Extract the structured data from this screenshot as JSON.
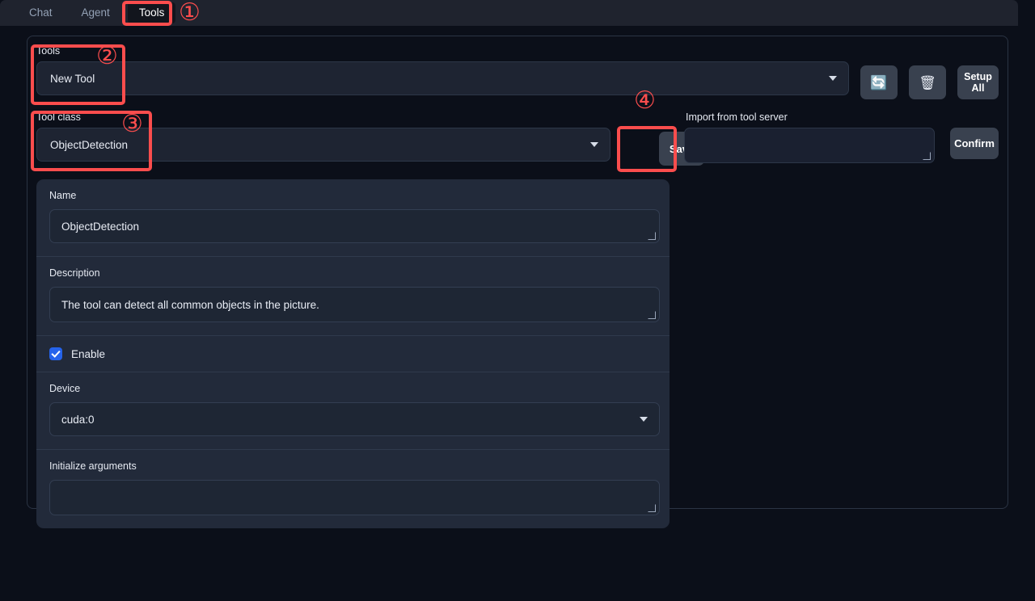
{
  "tabs": [
    {
      "label": "Chat",
      "active": false
    },
    {
      "label": "Agent",
      "active": false
    },
    {
      "label": "Tools",
      "active": true
    }
  ],
  "tools_row": {
    "label": "Tools",
    "selected": "New Tool",
    "caret_icon": "chevron-down-icon",
    "refresh_icon": "🔄",
    "delete_icon": "🗑",
    "setup_all_label": "Setup\nAll",
    "setup_all_line1": "Setup",
    "setup_all_line2": "All"
  },
  "class_row": {
    "label": "Tool class",
    "selected": "ObjectDetection",
    "save_label": "Save",
    "import_label": "Import from tool server",
    "import_value": "",
    "import_placeholder": "",
    "confirm_label": "Confirm"
  },
  "form": {
    "name_label": "Name",
    "name_value": "ObjectDetection",
    "description_label": "Description",
    "description_value": "The tool can detect all common objects in the picture.",
    "enable_label": "Enable",
    "enable_checked": true,
    "device_label": "Device",
    "device_value": "cuda:0",
    "init_args_label": "Initialize arguments",
    "init_args_value": ""
  },
  "annotations": {
    "numbers": [
      "①",
      "②",
      "③",
      "④"
    ],
    "color": "#fb4d4d"
  },
  "colors": {
    "page_bg": "#0b0f19",
    "header_bg": "#1f232e",
    "panel_bg": "#222a3a",
    "field_bg": "#1e2634",
    "button_bg": "#39414f",
    "accent_blue": "#2563eb",
    "text_primary": "#e9edf5",
    "text_muted": "#93a1b5",
    "annotation_red": "#fb4d4d"
  }
}
